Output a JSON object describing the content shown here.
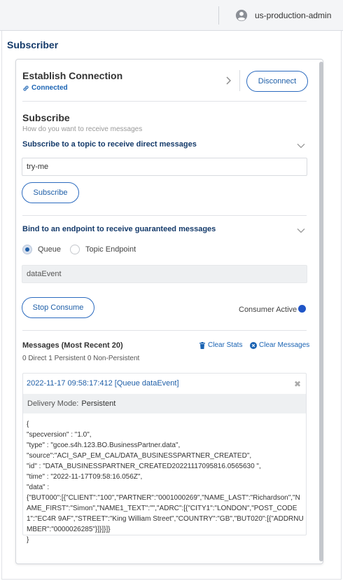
{
  "header": {
    "user": "us-production-admin"
  },
  "section_title": "Subscriber",
  "connection": {
    "title": "Establish Connection",
    "status": "Connected",
    "disconnect_label": "Disconnect"
  },
  "subscribe": {
    "title": "Subscribe",
    "subtitle": "How do you want to receive messages",
    "topic_heading": "Subscribe to a topic to receive direct messages",
    "topic_value": "try-me",
    "subscribe_label": "Subscribe",
    "endpoint_heading": "Bind to an endpoint to receive guaranteed messages",
    "option_queue": "Queue",
    "option_topic_endpoint": "Topic Endpoint",
    "selected_option": "Queue",
    "endpoint_value": "dataEvent",
    "stop_consume_label": "Stop Consume",
    "consumer_status": "Consumer Active",
    "consumer_status_color": "#1f55c7"
  },
  "messages": {
    "heading": "Messages  (Most Recent 20)",
    "counts": "0 Direct   1 Persistent   0 Non-Persistent",
    "clear_stats": "Clear Stats",
    "clear_messages": "Clear Messages",
    "item": {
      "title": "2022-11-17 09:58:17:412 [Queue dataEvent]",
      "mode_label": "Delivery Mode:",
      "mode_value": "Persistent",
      "body": "{\n\"specversion\" : \"1.0\",\n\"type\" : \"gcoe.s4h.123.BO.BusinessPartner.data\",\n\"source\":\"ACI_SAP_EM_CAL/DATA_BUSINESSPARTNER_CREATED\",\n\"id\" : \"DATA_BUSINESSPARTNER_CREATED20221117095816.0565630 \",\n\"time\" : \"2022-11-17T09:58:16.056Z\",\n\"data\" :\n{\"BUT000\":[{\"CLIENT\":\"100\",\"PARTNER\":\"0001000269\",\"NAME_LAST\":\"Richardson\",\"NAME_FIRST\":\"Simon\",\"NAME1_TEXT\":\"\",\"ADRC\":[{\"CITY1\":\"LONDON\",\"POST_CODE1\":\"EC4R 9AF\",\"STREET\":\"King William Street\",\"COUNTRY\":\"GB\",\"BUT020\":[{\"ADDRNUMBER\":\"0000026285\"}]}]}]}\n}"
    }
  }
}
